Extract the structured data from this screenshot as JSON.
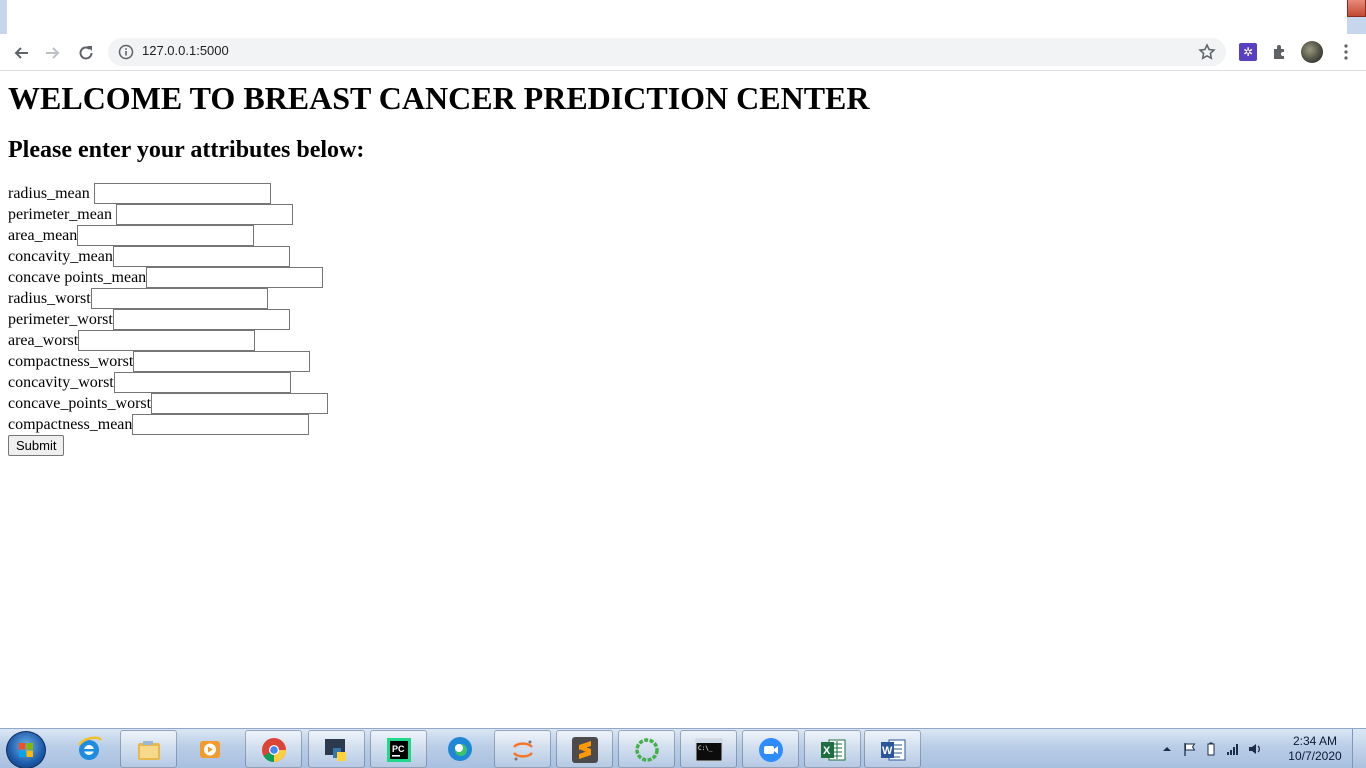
{
  "browser": {
    "url": "127.0.0.1:5000"
  },
  "page": {
    "heading": "WELCOME TO BREAST CANCER PREDICTION CENTER",
    "subheading": "Please enter your attributes below:",
    "fields": [
      {
        "label": "radius_mean",
        "value": ""
      },
      {
        "label": "perimeter_mean",
        "value": ""
      },
      {
        "label": "area_mean",
        "value": ""
      },
      {
        "label": "concavity_mean",
        "value": ""
      },
      {
        "label": "concave points_mean",
        "value": ""
      },
      {
        "label": "radius_worst",
        "value": ""
      },
      {
        "label": "perimeter_worst",
        "value": ""
      },
      {
        "label": "area_worst",
        "value": ""
      },
      {
        "label": "compactness_worst",
        "value": ""
      },
      {
        "label": "concavity_worst",
        "value": ""
      },
      {
        "label": "concave_points_worst",
        "value": ""
      },
      {
        "label": "compactness_mean",
        "value": ""
      }
    ],
    "submit_label": "Submit"
  },
  "taskbar": {
    "apps": [
      {
        "icon": "internet-explorer-icon"
      },
      {
        "icon": "file-explorer-icon"
      },
      {
        "icon": "media-player-icon"
      },
      {
        "icon": "chrome-icon"
      },
      {
        "icon": "python-idle-icon"
      },
      {
        "icon": "pycharm-icon"
      },
      {
        "icon": "edge-icon"
      },
      {
        "icon": "jupyter-icon"
      },
      {
        "icon": "sublime-text-icon"
      },
      {
        "icon": "anaconda-icon"
      },
      {
        "icon": "command-prompt-icon"
      },
      {
        "icon": "zoom-icon"
      },
      {
        "icon": "excel-icon"
      },
      {
        "icon": "word-icon"
      }
    ],
    "time": "2:34 AM",
    "date": "10/7/2020"
  },
  "colors": {
    "taskbar": "#b9cde6",
    "omnibox": "#f1f3f4",
    "close_button": "#c24934"
  }
}
